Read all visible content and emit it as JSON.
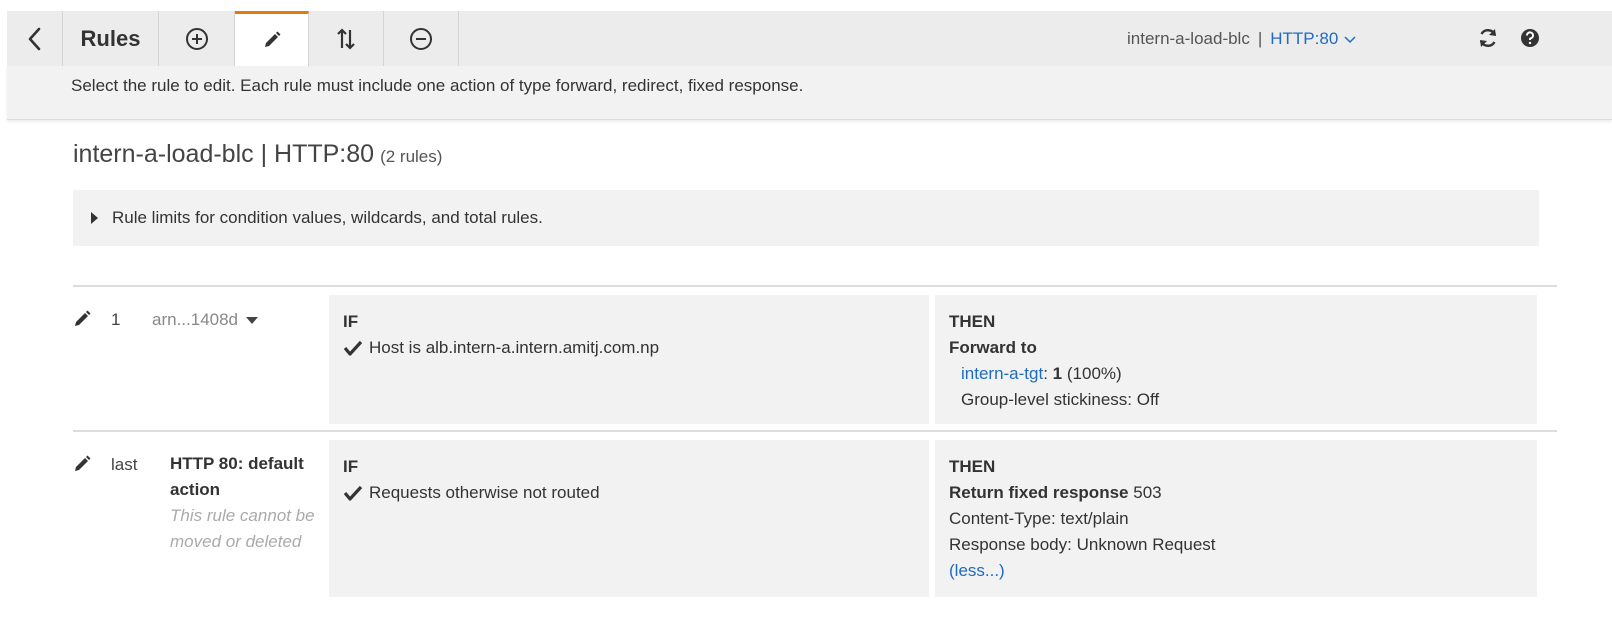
{
  "toolbar": {
    "title": "Rules",
    "lb_name": "intern-a-load-blc",
    "separator": "|",
    "listener": "HTTP:80"
  },
  "info": {
    "text": "Select the rule to edit. Each rule must include one action of type forward, redirect, fixed response."
  },
  "heading": {
    "title": "intern-a-load-blc | HTTP:80",
    "count": "(2 rules)"
  },
  "limits": {
    "label": "Rule limits for condition values, wildcards, and total rules."
  },
  "rules": [
    {
      "number": "1",
      "arn": "arn...1408d",
      "if_label": "IF",
      "condition_prefix": "Host is",
      "condition_value": "alb.intern-a.intern.amitj.com.np",
      "then_label": "THEN",
      "action": "Forward to",
      "target_link": "intern-a-tgt",
      "target_colon": ":",
      "target_weight": "1",
      "target_pct": "(100%)",
      "stickiness": "Group-level stickiness: Off"
    },
    {
      "number": "last",
      "name": "HTTP 80: default action",
      "note": "This rule cannot be moved or deleted",
      "if_label": "IF",
      "condition": "Requests otherwise not routed",
      "then_label": "THEN",
      "action": "Return fixed response",
      "status_code": "503",
      "content_type_label": "Content-Type:",
      "content_type": "text/plain",
      "body_label": "Response body:",
      "body": "Unknown Request",
      "less_link": "(less...)"
    }
  ],
  "colors": {
    "accent_link": "#1f6bbf",
    "active_tab": "#e47911",
    "panel_bg": "#f2f2f2"
  },
  "icons": [
    "back-icon",
    "add-icon",
    "edit-icon",
    "reorder-icon",
    "remove-icon",
    "chevron-down-icon",
    "refresh-icon",
    "help-icon",
    "pencil-icon",
    "check-icon",
    "caret-right-icon",
    "caret-down-icon"
  ]
}
